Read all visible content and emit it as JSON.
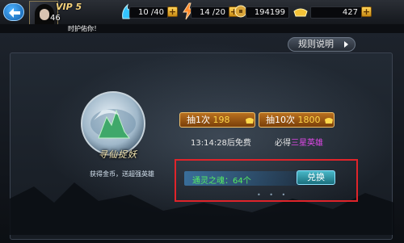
{
  "header": {
    "vip_label": "VIP 5",
    "level": "46",
    "resources": [
      {
        "icon": "stamina-icon",
        "value": "10 /40"
      },
      {
        "icon": "energy-icon",
        "value": "14 /20"
      },
      {
        "icon": "coin-icon",
        "value": "194199"
      },
      {
        "icon": "gold-ingot-icon",
        "value": "427"
      }
    ],
    "plus_symbol": "+"
  },
  "notice": {
    "text": "时护佑你！"
  },
  "panel": {
    "rules_button": "规则说明",
    "seal_text": "寻仙捉妖",
    "caption": "获得金币，送超强英雄",
    "draw_once": {
      "label": "抽1次",
      "cost": "198"
    },
    "draw_ten": {
      "label": "抽10次",
      "cost": "1800"
    },
    "free_timer": "13:14:28后免费",
    "guarantee_prefix": "必得",
    "guarantee_highlight": "三星英雄",
    "soul_label": "通灵之魂：64个",
    "exchange_button": "兑换",
    "page_dots": "• • •"
  },
  "colors": {
    "accent_gold": "#ffd84a",
    "highlight_purple": "#e048e8",
    "soul_green": "#55ee62",
    "box_red": "#e0242a"
  }
}
